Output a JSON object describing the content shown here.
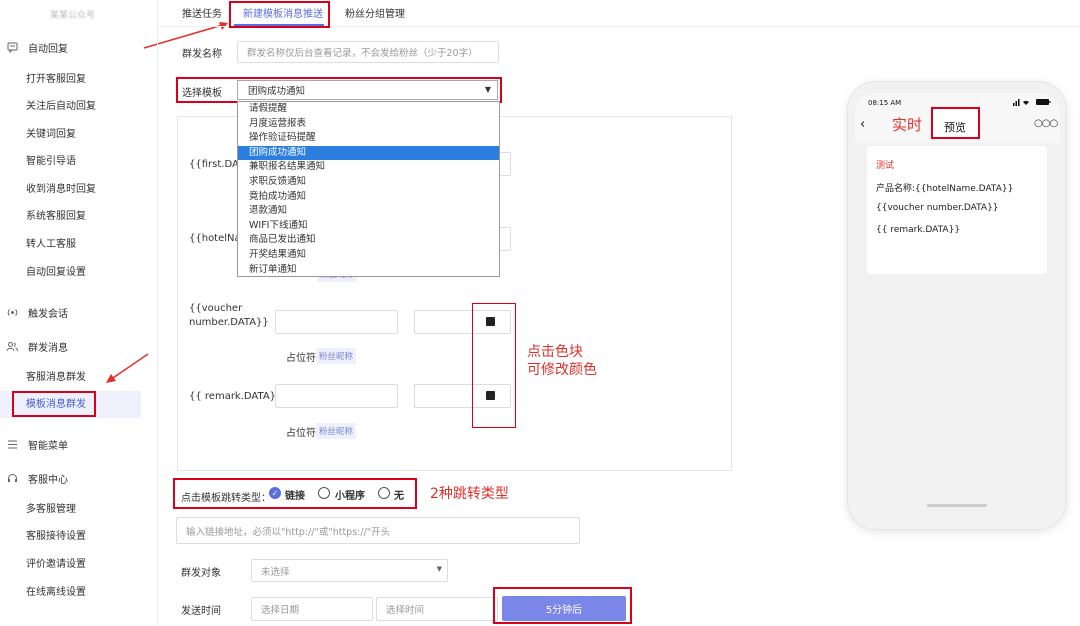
{
  "sidebar": {
    "logo_text": "某某公众号",
    "groups": [
      {
        "label": "自动回复",
        "icon": "chat-icon"
      },
      {
        "label": "触发会话",
        "icon": "broadcast-icon"
      },
      {
        "label": "群发消息",
        "icon": "users-icon"
      },
      {
        "label": "智能菜单",
        "icon": "menu-icon"
      },
      {
        "label": "客服中心",
        "icon": "headset-icon"
      }
    ],
    "auto_reply_items": [
      "打开客服回复",
      "关注后自动回复",
      "关键词回复",
      "智能引导语",
      "收到消息时回复",
      "系统客服回复",
      "转人工客服",
      "自动回复设置"
    ],
    "mass_items": [
      "客服消息群发",
      "模板消息群发"
    ],
    "service_items": [
      "多客服管理",
      "客服接待设置",
      "评价邀请设置",
      "在线离线设置"
    ]
  },
  "tabs": [
    "推送任务",
    "新建模板消息推送",
    "粉丝分组管理"
  ],
  "form": {
    "name_label": "群发名称",
    "name_placeholder": "群发名称仅后台查看记录，不会发给粉丝（少于20字）",
    "template_label": "选择模板",
    "template_selected": "团购成功通知",
    "template_options": [
      "请假提醒",
      "月度运营报表",
      "操作验证码提醒",
      "团购成功通知",
      "兼职报名结果通知",
      "求职反馈通知",
      "竟拍成功通知",
      "退款通知",
      "WIFI下线通知",
      "商品已发出通知",
      "开奖结果通知",
      "新订单通知"
    ],
    "fields": [
      {
        "label": "{{first.DATA}}"
      },
      {
        "label": "{{hotelName.DATA}}",
        "visible_label": "{{hotelNam"
      },
      {
        "label_line1": "{{voucher",
        "label_line2": "number.DATA}}"
      },
      {
        "label": "{{ remark.DATA}}"
      }
    ],
    "placeholder_label": "占位符",
    "placeholder_tag": "粉丝昵称",
    "jump_label": "点击模板跳转类型：",
    "jump_options": [
      "链接",
      "小程序",
      "无"
    ],
    "jump_selected": "链接",
    "link_placeholder": "输入链接地址，必须以\"http://\"或\"https://\"开头",
    "target_label": "群发对象",
    "target_value": "未选择",
    "time_label": "发送时间",
    "date_placeholder": "选择日期",
    "time_placeholder": "选择时间",
    "submit_label": "5分钟后"
  },
  "phone": {
    "time": "08:15 AM",
    "title": "预览",
    "back_icon": "chevron-left-icon",
    "more_icon": "more-icon",
    "card_title": "测试",
    "card_lines": [
      "产品名称:{{hotelName.DATA}}",
      "{{voucher number.DATA}}",
      "{{ remark.DATA}}"
    ]
  },
  "annotations": {
    "realtime": "实时",
    "color_line1": "点击色块",
    "color_line2": "可修改颜色",
    "jump_types": "2种跳转类型"
  },
  "colors": {
    "accent": "#5b6ee1",
    "annotation": "#d9001b",
    "dropdown_highlight": "#2b7de0"
  }
}
